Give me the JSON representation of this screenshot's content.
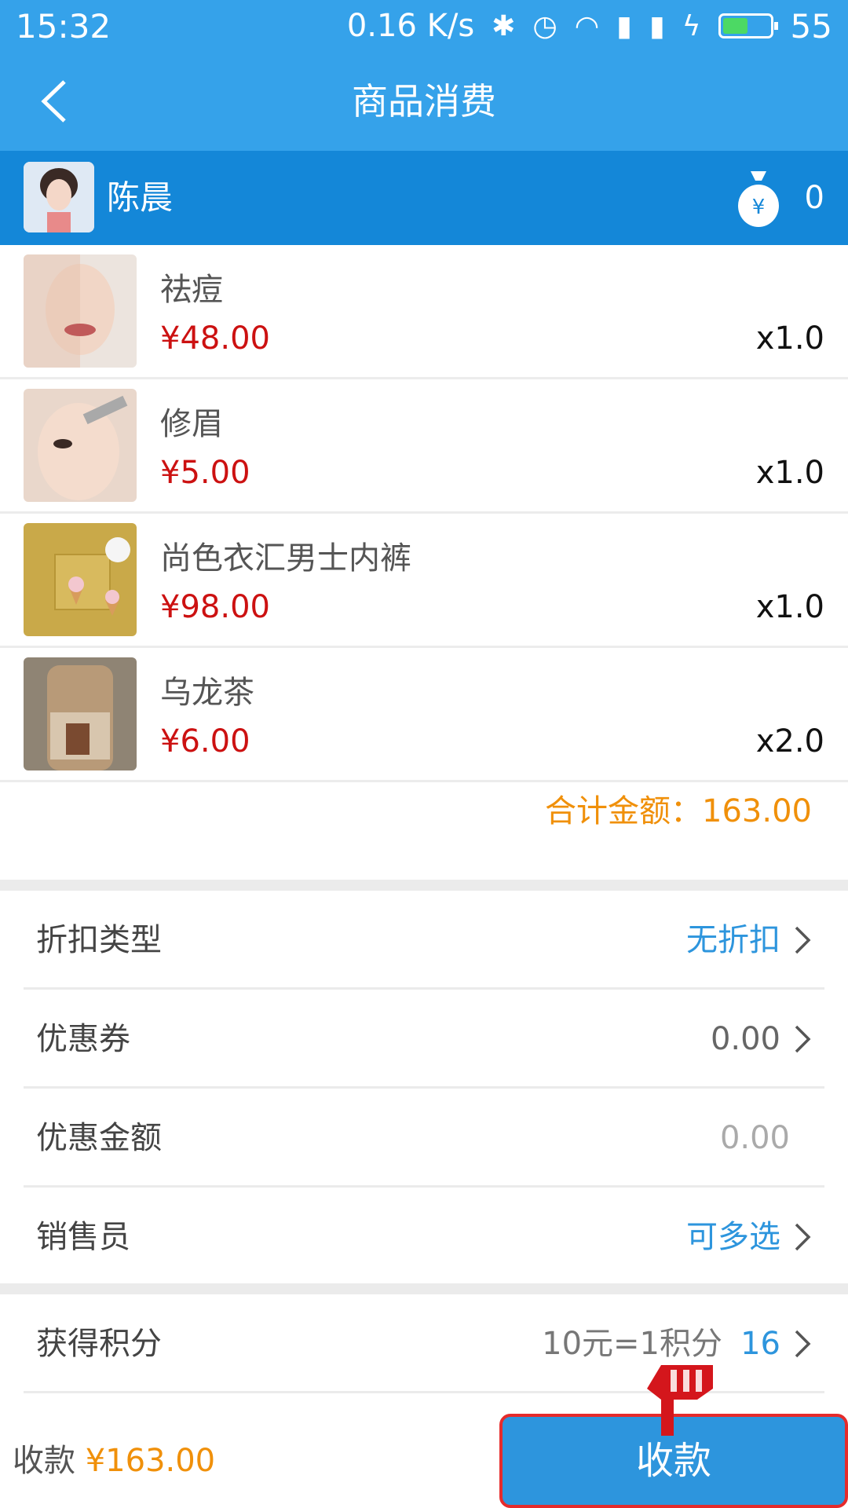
{
  "status_bar": {
    "time": "15:32",
    "speed": "0.16 K/s",
    "battery": "55",
    "battery_level": 0.55
  },
  "nav": {
    "title": "商品消费",
    "back_icon": "chevron-left-icon"
  },
  "member": {
    "name": "陈晨",
    "points": "0",
    "icon": "money-bag-icon"
  },
  "items": [
    {
      "name": "祛痘",
      "price": "¥48.00",
      "qty": "x1.0"
    },
    {
      "name": "修眉",
      "price": "¥5.00",
      "qty": "x1.0"
    },
    {
      "name": "尚色衣汇男士内裤",
      "price": "¥98.00",
      "qty": "x1.0"
    },
    {
      "name": "乌龙茶",
      "price": "¥6.00",
      "qty": "x2.0"
    }
  ],
  "total": "合计金额：163.00",
  "rows": {
    "discount_type": {
      "label": "折扣类型",
      "value": "无折扣"
    },
    "coupon": {
      "label": "优惠券",
      "value": "0.00"
    },
    "discount_amount": {
      "label": "优惠金额",
      "value": "0.00"
    },
    "salesperson": {
      "label": "销售员",
      "value": "可多选"
    },
    "points": {
      "label": "获得积分",
      "rule": "10元=1积分",
      "value": "16"
    }
  },
  "footer": {
    "label": "收款",
    "amount": "¥163.00",
    "pay_button": "收款"
  },
  "colors": {
    "primary": "#35a2ea",
    "member_bar": "#1487d8",
    "price_red": "#cc1111",
    "total_orange": "#f0900a",
    "link_blue": "#2d95dd",
    "highlight_red": "#e52b2b"
  }
}
